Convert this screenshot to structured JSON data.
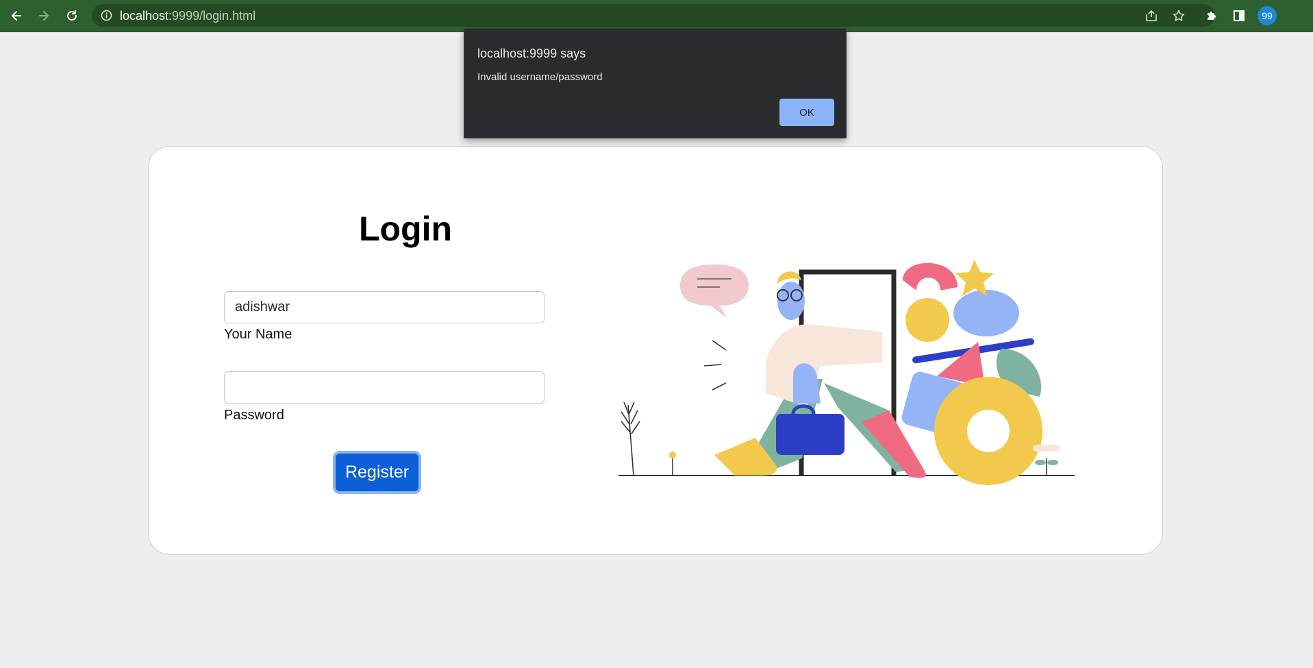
{
  "browser": {
    "url_host": "localhost",
    "url_path": ":9999/login.html",
    "profile_badge": "99",
    "icons": {
      "back": "back-arrow-icon",
      "forward": "forward-arrow-icon",
      "reload": "reload-icon",
      "info": "info-icon",
      "share": "share-icon",
      "bookmark": "star-icon",
      "extensions": "puzzle-icon",
      "side_panel": "side-panel-icon"
    }
  },
  "alert": {
    "title": "localhost:9999 says",
    "message": "Invalid username/password",
    "ok_label": "OK"
  },
  "login": {
    "title": "Login",
    "username_value": "adishwar",
    "username_label": "Your Name",
    "password_value": "",
    "password_label": "Password",
    "submit_label": "Register"
  },
  "colors": {
    "chrome_toolbar": "#2e5f2e",
    "page_bg": "#eeeeee",
    "primary_button": "#0b5fd7",
    "alert_ok": "#8ab4f8"
  }
}
